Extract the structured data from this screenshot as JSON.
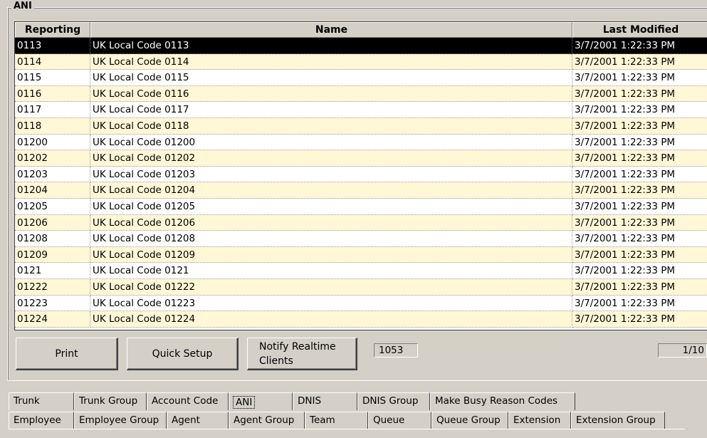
{
  "group": {
    "title": "ANI"
  },
  "grid": {
    "columns": [
      "Reporting",
      "Name",
      "Last Modified"
    ],
    "rows": [
      {
        "reporting": "0113",
        "name": "UK Local Code 0113",
        "modified": "3/7/2001 1:22:33 PM"
      },
      {
        "reporting": "0114",
        "name": "UK Local Code 0114",
        "modified": "3/7/2001 1:22:33 PM"
      },
      {
        "reporting": "0115",
        "name": "UK Local Code 0115",
        "modified": "3/7/2001 1:22:33 PM"
      },
      {
        "reporting": "0116",
        "name": "UK Local Code 0116",
        "modified": "3/7/2001 1:22:33 PM"
      },
      {
        "reporting": "0117",
        "name": "UK Local Code 0117",
        "modified": "3/7/2001 1:22:33 PM"
      },
      {
        "reporting": "0118",
        "name": "UK Local Code 0118",
        "modified": "3/7/2001 1:22:33 PM"
      },
      {
        "reporting": "01200",
        "name": "UK Local Code 01200",
        "modified": "3/7/2001 1:22:33 PM"
      },
      {
        "reporting": "01202",
        "name": "UK Local Code 01202",
        "modified": "3/7/2001 1:22:33 PM"
      },
      {
        "reporting": "01203",
        "name": "UK Local Code 01203",
        "modified": "3/7/2001 1:22:33 PM"
      },
      {
        "reporting": "01204",
        "name": "UK Local Code 01204",
        "modified": "3/7/2001 1:22:33 PM"
      },
      {
        "reporting": "01205",
        "name": "UK Local Code 01205",
        "modified": "3/7/2001 1:22:33 PM"
      },
      {
        "reporting": "01206",
        "name": "UK Local Code 01206",
        "modified": "3/7/2001 1:22:33 PM"
      },
      {
        "reporting": "01208",
        "name": "UK Local Code 01208",
        "modified": "3/7/2001 1:22:33 PM"
      },
      {
        "reporting": "01209",
        "name": "UK Local Code 01209",
        "modified": "3/7/2001 1:22:33 PM"
      },
      {
        "reporting": "0121",
        "name": "UK Local Code 0121",
        "modified": "3/7/2001 1:22:33 PM"
      },
      {
        "reporting": "01222",
        "name": "UK Local Code 01222",
        "modified": "3/7/2001 1:22:33 PM"
      },
      {
        "reporting": "01223",
        "name": "UK Local Code 01223",
        "modified": "3/7/2001 1:22:33 PM"
      },
      {
        "reporting": "01224",
        "name": "UK Local Code 01224",
        "modified": "3/7/2001 1:22:33 PM"
      }
    ]
  },
  "buttons": {
    "print": "Print",
    "quick_setup": "Quick Setup",
    "notify_line1": "Notify Realtime",
    "notify_line2": "Clients"
  },
  "record_count": "1053",
  "page_indicator": "1/10",
  "tabs": {
    "row1": [
      "Trunk",
      "Trunk Group",
      "Account Code",
      "ANI",
      "DNIS",
      "DNIS Group",
      "Make Busy Reason Codes"
    ],
    "row2": [
      "Employee",
      "Employee Group",
      "Agent",
      "Agent Group",
      "Team",
      "Queue",
      "Queue Group",
      "Extension",
      "Extension Group"
    ],
    "active": "ANI"
  },
  "colors": {
    "row_alt": "#fff7d6",
    "selected_row": "#000000",
    "face": "#d4d0c8"
  }
}
